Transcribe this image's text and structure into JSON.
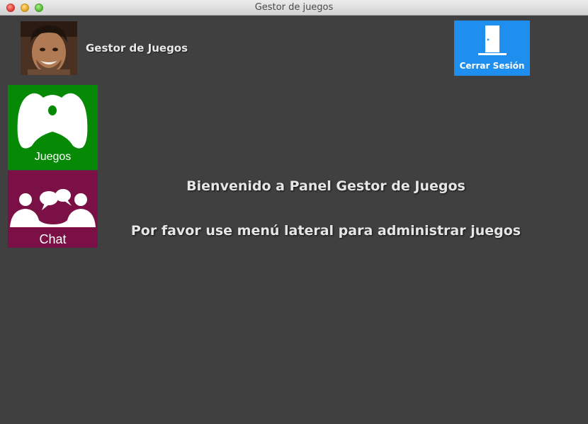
{
  "window": {
    "title": "Gestor de juegos"
  },
  "header": {
    "title": "Gestor de Juegos",
    "logout_label": "Cerrar Sesión"
  },
  "sidebar": {
    "tiles": [
      {
        "label": "Juegos",
        "icon": "gamepad-icon",
        "color": "#068a06"
      },
      {
        "label": "Chat",
        "icon": "chat-people-icon",
        "color": "#7a1046"
      }
    ]
  },
  "main": {
    "welcome": "Bienvenido a Panel Gestor de Juegos",
    "instructions": "Por favor use menú lateral para administrar juegos"
  },
  "colors": {
    "background": "#404040",
    "logout_button": "#1e8fee",
    "text": "#e6e6e6"
  }
}
